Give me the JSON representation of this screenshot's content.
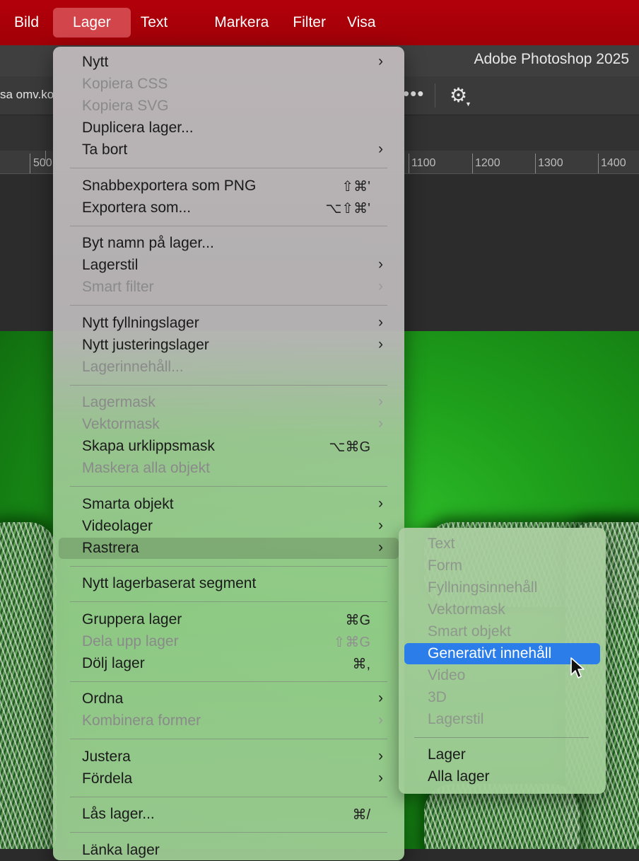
{
  "menubar": {
    "items": [
      "Bild",
      "Lager",
      "Text",
      "Markera",
      "Filter",
      "Visa"
    ],
    "active": "Lager"
  },
  "window": {
    "title": "Adobe Photoshop 2025"
  },
  "options_bar": {
    "partial_text": "sa omv.ko",
    "more_icon": "ellipsis-icon",
    "settings_icon": "gear-icon"
  },
  "ruler": {
    "labels": [
      "500",
      "1100",
      "1200",
      "1300",
      "1400"
    ]
  },
  "menu": {
    "groups": [
      [
        {
          "label": "Nytt",
          "submenu": true,
          "enabled": true
        },
        {
          "label": "Kopiera CSS",
          "enabled": false
        },
        {
          "label": "Kopiera SVG",
          "enabled": false
        },
        {
          "label": "Duplicera lager...",
          "enabled": true
        },
        {
          "label": "Ta bort",
          "submenu": true,
          "enabled": true
        }
      ],
      [
        {
          "label": "Snabbexportera som PNG",
          "shortcut": "⇧⌘'",
          "enabled": true
        },
        {
          "label": "Exportera som...",
          "shortcut": "⌥⇧⌘'",
          "enabled": true
        }
      ],
      [
        {
          "label": "Byt namn på lager...",
          "enabled": true
        },
        {
          "label": "Lagerstil",
          "submenu": true,
          "enabled": true
        },
        {
          "label": "Smart filter",
          "submenu": true,
          "enabled": false
        }
      ],
      [
        {
          "label": "Nytt fyllningslager",
          "submenu": true,
          "enabled": true
        },
        {
          "label": "Nytt justeringslager",
          "submenu": true,
          "enabled": true
        },
        {
          "label": "Lagerinnehåll...",
          "enabled": false
        }
      ],
      [
        {
          "label": "Lagermask",
          "submenu": true,
          "enabled": false
        },
        {
          "label": "Vektormask",
          "submenu": true,
          "enabled": false
        },
        {
          "label": "Skapa urklippsmask",
          "shortcut": "⌥⌘G",
          "enabled": true
        },
        {
          "label": "Maskera alla objekt",
          "enabled": false
        }
      ],
      [
        {
          "label": "Smarta objekt",
          "submenu": true,
          "enabled": true
        },
        {
          "label": "Videolager",
          "submenu": true,
          "enabled": true
        },
        {
          "label": "Rastrera",
          "submenu": true,
          "enabled": true,
          "highlighted": true
        }
      ],
      [
        {
          "label": "Nytt lagerbaserat segment",
          "enabled": true
        }
      ],
      [
        {
          "label": "Gruppera lager",
          "shortcut": "⌘G",
          "enabled": true
        },
        {
          "label": "Dela upp lager",
          "shortcut": "⇧⌘G",
          "enabled": false
        },
        {
          "label": "Dölj lager",
          "shortcut": "⌘,",
          "enabled": true
        }
      ],
      [
        {
          "label": "Ordna",
          "submenu": true,
          "enabled": true
        },
        {
          "label": "Kombinera former",
          "submenu": true,
          "enabled": false
        }
      ],
      [
        {
          "label": "Justera",
          "submenu": true,
          "enabled": true
        },
        {
          "label": "Fördela",
          "submenu": true,
          "enabled": true
        }
      ],
      [
        {
          "label": "Lås lager...",
          "shortcut": "⌘/",
          "enabled": true
        }
      ],
      [
        {
          "label": "Länka lager",
          "enabled": true
        }
      ]
    ]
  },
  "submenu": {
    "parent": "Rastrera",
    "groups": [
      [
        {
          "label": "Text",
          "enabled": false
        },
        {
          "label": "Form",
          "enabled": false
        },
        {
          "label": "Fyllningsinnehåll",
          "enabled": false
        },
        {
          "label": "Vektormask",
          "enabled": false
        },
        {
          "label": "Smart objekt",
          "enabled": false
        },
        {
          "label": "Generativt innehåll",
          "enabled": true,
          "selected": true
        },
        {
          "label": "Video",
          "enabled": false
        },
        {
          "label": "3D",
          "enabled": false
        },
        {
          "label": "Lagerstil",
          "enabled": false
        }
      ],
      [
        {
          "label": "Lager",
          "enabled": true
        },
        {
          "label": "Alla lager",
          "enabled": true
        }
      ]
    ]
  },
  "colors": {
    "menubar": "#a8000a",
    "selection": "#2b7de9",
    "canvas_green": "#1e9e1b"
  }
}
